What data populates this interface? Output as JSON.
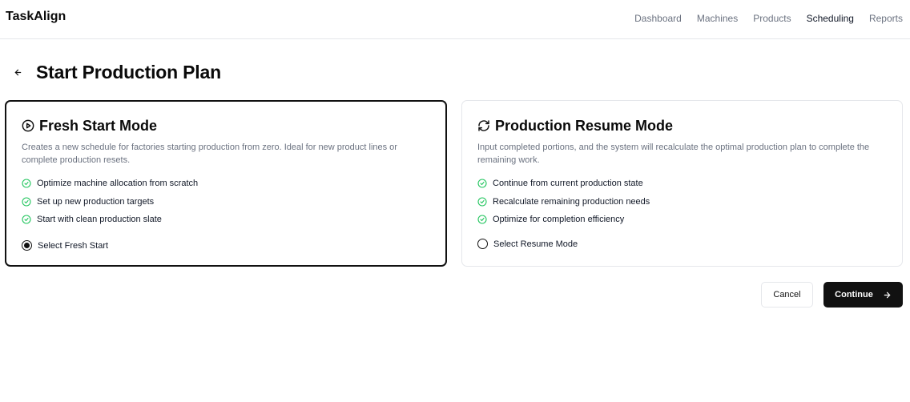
{
  "app": {
    "brand": "TaskAlign"
  },
  "nav": {
    "items": [
      {
        "label": "Dashboard",
        "active": false
      },
      {
        "label": "Machines",
        "active": false
      },
      {
        "label": "Products",
        "active": false
      },
      {
        "label": "Scheduling",
        "active": true
      },
      {
        "label": "Reports",
        "active": false
      }
    ]
  },
  "page": {
    "title": "Start Production Plan",
    "back_icon": "arrow-left-icon"
  },
  "cards": {
    "fresh": {
      "icon": "play-circle-icon",
      "title": "Fresh Start Mode",
      "description": "Creates a new schedule for factories starting production from zero. Ideal for new product lines or complete production resets.",
      "features": [
        "Optimize machine allocation from scratch",
        "Set up new production targets",
        "Start with clean production slate"
      ],
      "select_label": "Select Fresh Start",
      "selected": true
    },
    "resume": {
      "icon": "refresh-icon",
      "title": "Production Resume Mode",
      "description": "Input completed portions, and the system will recalculate the optimal production plan to complete the remaining work.",
      "features": [
        "Continue from current production state",
        "Recalculate remaining production needs",
        "Optimize for completion efficiency"
      ],
      "select_label": "Select Resume Mode",
      "selected": false
    }
  },
  "actions": {
    "cancel_label": "Cancel",
    "continue_label": "Continue",
    "continue_icon": "arrow-right-icon"
  },
  "colors": {
    "primary": "#111111",
    "check": "#22c55e",
    "muted": "#6b7280",
    "border": "#e5e7eb"
  }
}
